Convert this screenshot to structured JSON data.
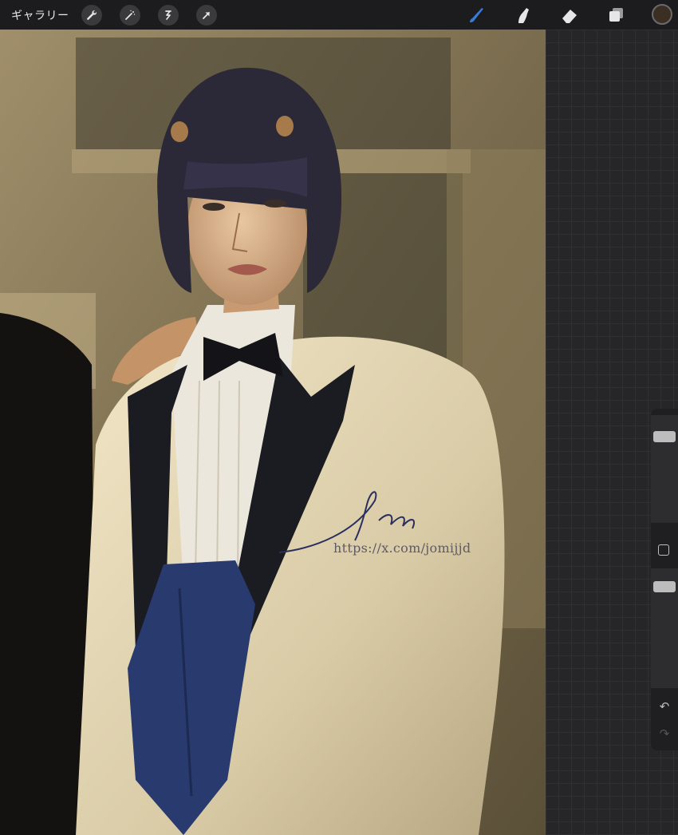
{
  "topbar": {
    "gallery_label": "ギャラリー",
    "left_tools": [
      "wrench-icon",
      "magic-wand-icon",
      "selection-icon",
      "transform-arrow-icon"
    ],
    "right_tools": [
      "brush-icon",
      "smudge-icon",
      "eraser-icon",
      "layers-icon"
    ],
    "accent_color": "#3a7bd5",
    "current_color": "#3a2f22"
  },
  "canvas": {
    "watermark_url": "https://x.com/jomijjd",
    "signature": "Jomi"
  },
  "sidebar": {
    "brush_size_level": 0.92,
    "opacity_level": 0.96,
    "undo_icon": "undo-icon",
    "redo_icon": "redo-icon"
  }
}
